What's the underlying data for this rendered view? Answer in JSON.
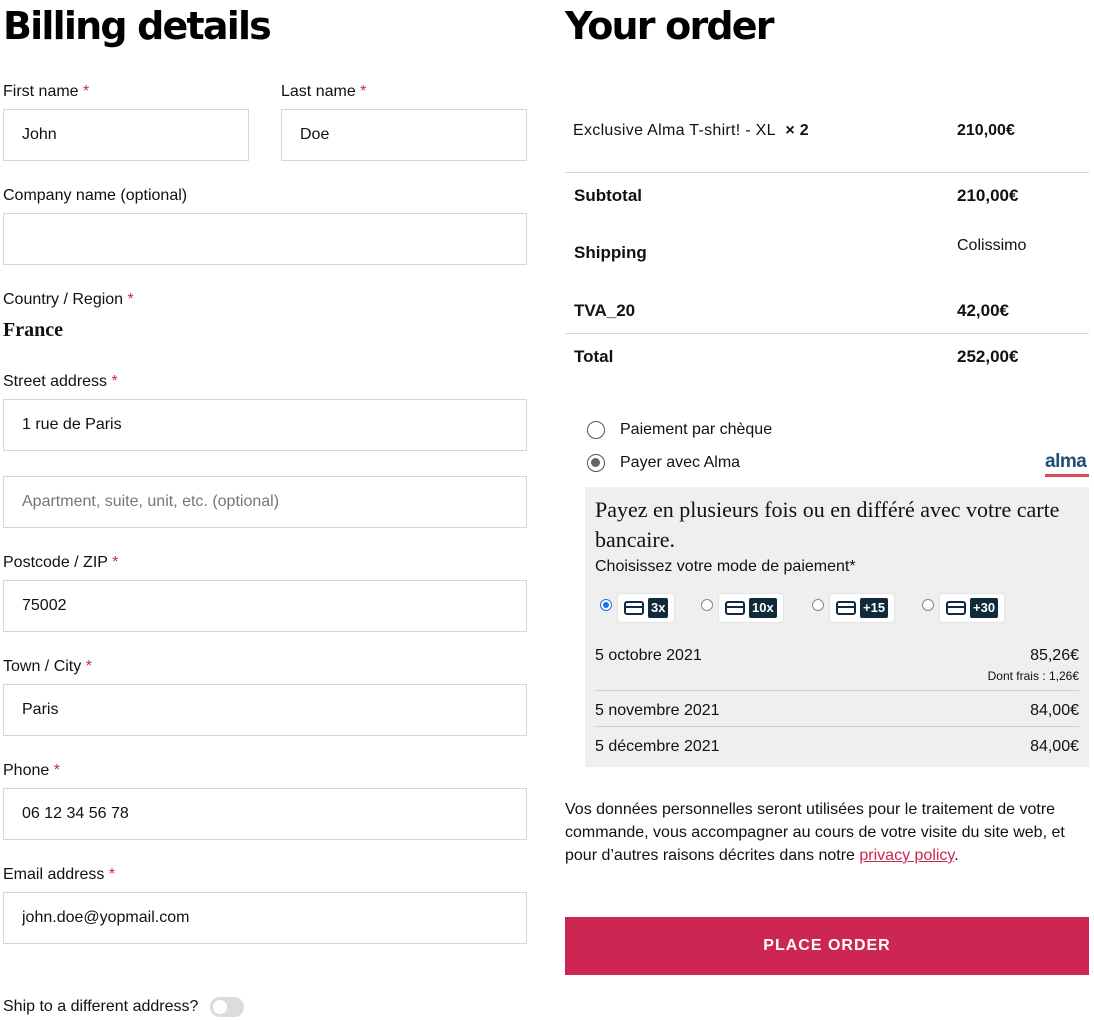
{
  "billing": {
    "title": "Billing details",
    "required_mark": "*",
    "first_name": {
      "label": "First name",
      "value": "John"
    },
    "last_name": {
      "label": "Last name",
      "value": "Doe"
    },
    "company": {
      "label": "Company name (optional)",
      "value": ""
    },
    "country": {
      "label": "Country / Region",
      "value": "France"
    },
    "street": {
      "label": "Street address",
      "value": "1 rue de Paris",
      "apartment_placeholder": "Apartment, suite, unit, etc. (optional)"
    },
    "postcode": {
      "label": "Postcode / ZIP",
      "value": "75002"
    },
    "city": {
      "label": "Town / City",
      "value": "Paris"
    },
    "phone": {
      "label": "Phone",
      "value": "06 12 34 56 78"
    },
    "email": {
      "label": "Email address",
      "value": "john.doe@yopmail.com"
    },
    "ship_different": {
      "label": "Ship to a different address?",
      "enabled": false
    }
  },
  "order": {
    "title": "Your order",
    "item": {
      "name": "Exclusive Alma T-shirt! - XL",
      "qty": "× 2",
      "price": "210,00€"
    },
    "subtotal": {
      "label": "Subtotal",
      "value": "210,00€"
    },
    "shipping": {
      "label": "Shipping",
      "value": "Colissimo"
    },
    "tax": {
      "label": "TVA_20",
      "value": "42,00€"
    },
    "total": {
      "label": "Total",
      "value": "252,00€"
    }
  },
  "payment": {
    "methods": [
      {
        "label": "Paiement par chèque",
        "selected": false
      },
      {
        "label": "Payer avec Alma",
        "selected": true
      }
    ],
    "alma_logo": "alma",
    "alma": {
      "title": "Payez en plusieurs fois ou en différé avec votre carte bancaire.",
      "subtitle": "Choisissez votre mode de paiement*",
      "plans": [
        {
          "badge": "3x",
          "selected": true,
          "icon": "credit-card-icon"
        },
        {
          "badge": "10x",
          "selected": false,
          "icon": "credit-card-icon"
        },
        {
          "badge": "+15",
          "selected": false,
          "icon": "credit-card-icon"
        },
        {
          "badge": "+30",
          "selected": false,
          "icon": "credit-card-icon"
        }
      ],
      "schedule": [
        {
          "date": "5 octobre 2021",
          "amount": "85,26€"
        },
        {
          "date": "5 novembre 2021",
          "amount": "84,00€"
        },
        {
          "date": "5 décembre 2021",
          "amount": "84,00€"
        }
      ],
      "fees": "Dont frais : 1,26€"
    }
  },
  "privacy": {
    "text": "Vos données personnelles seront utilisées pour le traitement de votre commande, vous accompagner au cours de votre visite du site web, et pour d’autres raisons décrites dans notre ",
    "link": "privacy policy",
    "end": "."
  },
  "place_order": "PLACE ORDER",
  "colors": {
    "accent": "#cd2653",
    "alma_blue": "#1f4e79",
    "alma_badge": "#0f2a3a",
    "panel_bg": "#efefef"
  }
}
